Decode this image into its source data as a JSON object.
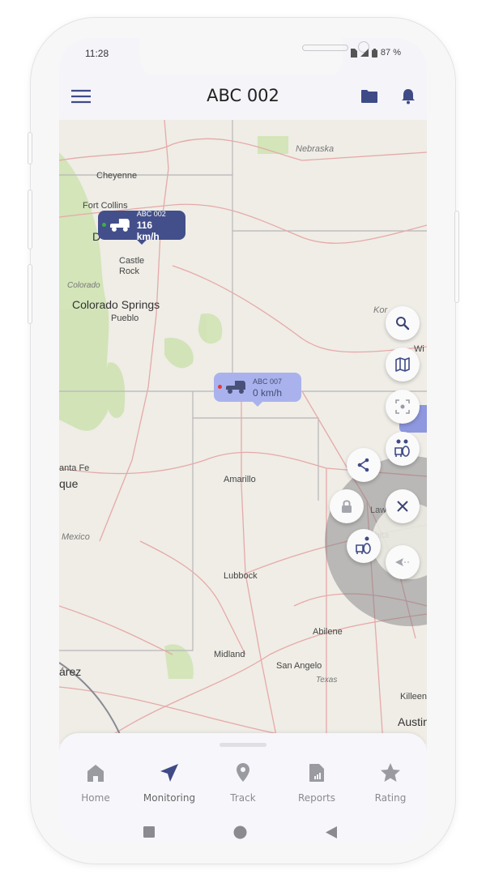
{
  "status_bar": {
    "time": "11:28",
    "battery": "87 %"
  },
  "app_bar": {
    "title": "ABC 002",
    "menu_icon": "hamburger-menu-icon",
    "folder_icon": "folder-icon",
    "bell_icon": "bell-icon"
  },
  "colors": {
    "accent": "#3f4b86",
    "marker_dark": "#434f8a",
    "marker_light": "#aab2ee",
    "online_dot": "#3cb043",
    "offline_dot": "#e53935"
  },
  "map": {
    "labels": [
      {
        "text": "Nebraska",
        "style": "it"
      },
      {
        "text": "Cheyenne",
        "style": ""
      },
      {
        "text": "Fort Collins",
        "style": ""
      },
      {
        "text": "D",
        "style": "big"
      },
      {
        "text": "Castle",
        "style": ""
      },
      {
        "text": "Rock",
        "style": ""
      },
      {
        "text": "Colorado",
        "style": "it"
      },
      {
        "text": "Colorado Springs",
        "style": "big"
      },
      {
        "text": "Pueblo",
        "style": ""
      },
      {
        "text": "Kor",
        "style": "it"
      },
      {
        "text": "Wi",
        "style": ""
      },
      {
        "text": "anta Fe",
        "style": ""
      },
      {
        "text": "que",
        "style": "big"
      },
      {
        "text": "Amarillo",
        "style": ""
      },
      {
        "text": "Mexico",
        "style": "it"
      },
      {
        "text": "Lubbock",
        "style": ""
      },
      {
        "text": "Law",
        "style": ""
      },
      {
        "text": "chita",
        "style": ""
      },
      {
        "text": "Abilene",
        "style": ""
      },
      {
        "text": "Midland",
        "style": ""
      },
      {
        "text": "árez",
        "style": "big"
      },
      {
        "text": "San Angelo",
        "style": ""
      },
      {
        "text": "Texas",
        "style": "it"
      },
      {
        "text": "Killeen",
        "style": ""
      },
      {
        "text": "Austin",
        "style": "big"
      }
    ],
    "markers": [
      {
        "name": "ABC 002",
        "speed": "116 km/h",
        "status": "online"
      },
      {
        "name": "ABC 007",
        "speed": "0 km/h",
        "status": "offline"
      }
    ]
  },
  "map_controls": [
    "search-icon",
    "map-icon",
    "focus-icon",
    "vehicle-driver-icon"
  ],
  "radial_menu": [
    "share-icon",
    "lock-icon",
    "close-icon",
    "assign-driver-icon",
    "navigate-back-icon"
  ],
  "bottom_nav": [
    {
      "label": "Home",
      "icon": "home-icon",
      "active": false
    },
    {
      "label": "Monitoring",
      "icon": "navigation-icon",
      "active": true
    },
    {
      "label": "Track",
      "icon": "location-pin-icon",
      "active": false
    },
    {
      "label": "Reports",
      "icon": "report-icon",
      "active": false
    },
    {
      "label": "Rating",
      "icon": "star-icon",
      "active": false
    }
  ]
}
